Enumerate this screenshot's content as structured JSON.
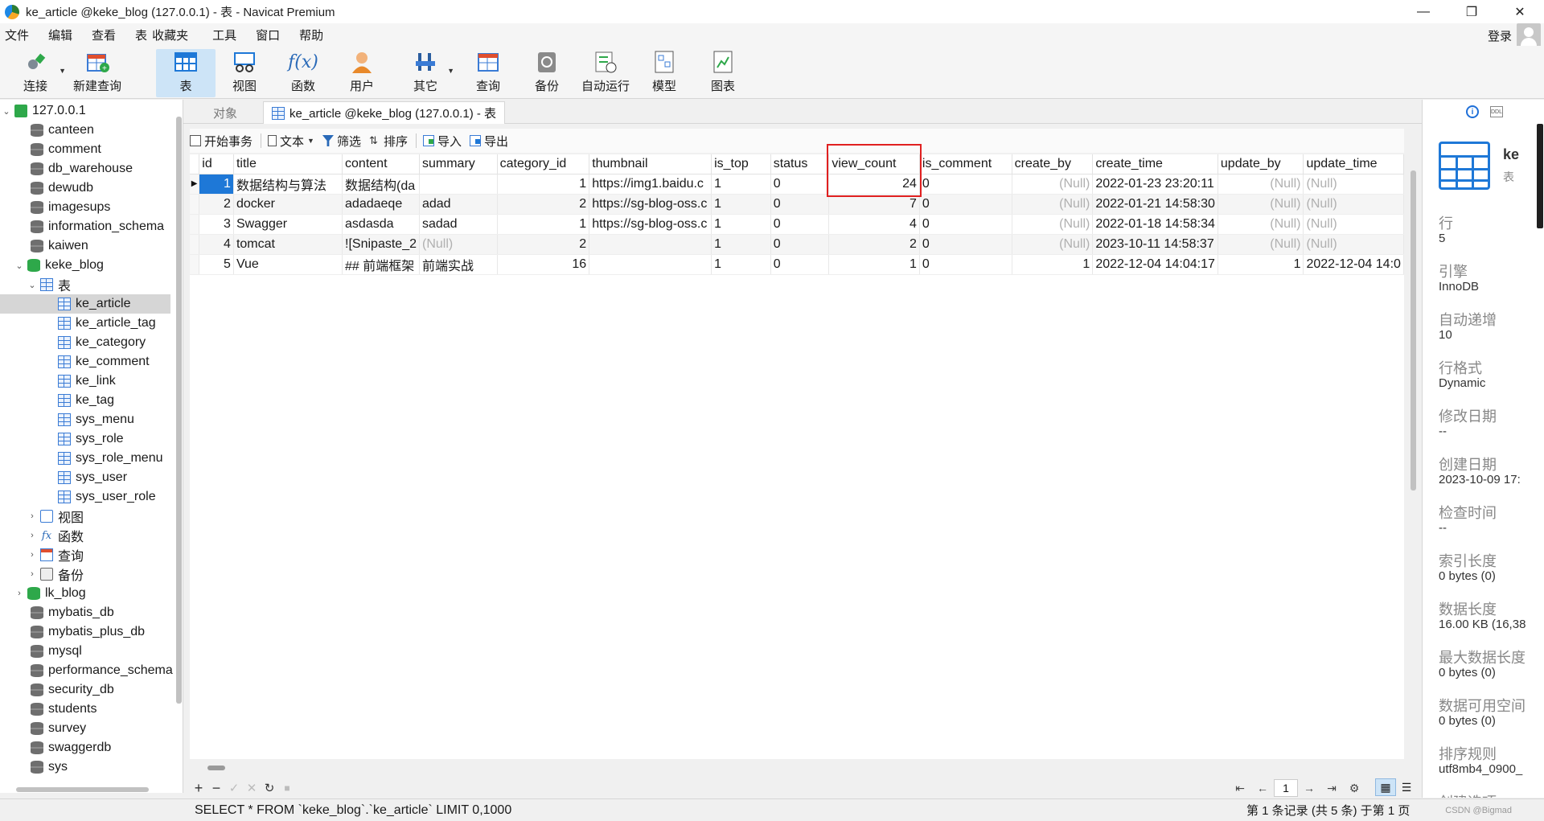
{
  "window": {
    "title": "ke_article @keke_blog (127.0.0.1) - 表 - Navicat Premium",
    "controls": [
      "—",
      "❐",
      "✕"
    ]
  },
  "menu": [
    "文件",
    "编辑",
    "查看",
    "表",
    "收藏夹",
    "工具",
    "窗口",
    "帮助"
  ],
  "login_label": "登录",
  "toolbar": {
    "connect": "连接",
    "new_query": "新建查询",
    "table": "表",
    "view": "视图",
    "function": "函数",
    "user": "用户",
    "other": "其它",
    "query": "查询",
    "backup": "备份",
    "automation": "自动运行",
    "model": "模型",
    "chart": "图表"
  },
  "tree": {
    "server": "127.0.0.1",
    "databases_top": [
      "canteen",
      "comment",
      "db_warehouse",
      "dewudb",
      "imagesups",
      "information_schema",
      "kaiwen"
    ],
    "active_db": "keke_blog",
    "tables_folder": "表",
    "tables": [
      "ke_article",
      "ke_article_tag",
      "ke_category",
      "ke_comment",
      "ke_link",
      "ke_tag",
      "sys_menu",
      "sys_role",
      "sys_role_menu",
      "sys_user",
      "sys_user_role"
    ],
    "folders": [
      "视图",
      "函数",
      "查询",
      "备份"
    ],
    "databases_bottom": [
      "lk_blog",
      "mybatis_db",
      "mybatis_plus_db",
      "mysql",
      "performance_schema",
      "security_db",
      "students",
      "survey",
      "swaggerdb",
      "sys"
    ]
  },
  "tabs": {
    "objects": "对象",
    "active": "ke_article @keke_blog (127.0.0.1) - 表"
  },
  "content_toolbar": {
    "begin_tx": "开始事务",
    "text": "文本",
    "filter": "筛选",
    "sort": "排序",
    "import": "导入",
    "export": "导出"
  },
  "grid": {
    "columns": [
      "id",
      "title",
      "content",
      "summary",
      "category_id",
      "thumbnail",
      "is_top",
      "status",
      "view_count",
      "is_comment",
      "create_by",
      "create_time",
      "update_by",
      "update_time"
    ],
    "rows": [
      [
        "1",
        "数据结构与算法",
        "数据结构(da",
        "",
        "1",
        "https://img1.baidu.c",
        "1",
        "0",
        "24",
        "0",
        "(Null)",
        "2022-01-23 23:20:11",
        "(Null)",
        "(Null)"
      ],
      [
        "2",
        "docker",
        "adadaeqe",
        "adad",
        "2",
        "https://sg-blog-oss.c",
        "1",
        "0",
        "7",
        "0",
        "(Null)",
        "2022-01-21 14:58:30",
        "(Null)",
        "(Null)"
      ],
      [
        "3",
        "Swagger",
        "asdasda",
        "sadad",
        "1",
        "https://sg-blog-oss.c",
        "1",
        "0",
        "4",
        "0",
        "(Null)",
        "2022-01-18 14:58:34",
        "(Null)",
        "(Null)"
      ],
      [
        "4",
        "tomcat",
        "![Snipaste_2",
        "(Null)",
        "2",
        "",
        "1",
        "0",
        "2",
        "0",
        "(Null)",
        "2023-10-11 14:58:37",
        "(Null)",
        "(Null)"
      ],
      [
        "5",
        "Vue",
        "## 前端框架",
        "前端实战",
        "16",
        "",
        "1",
        "0",
        "1",
        "0",
        "1",
        "2022-12-04 14:04:17",
        "1",
        "2022-12-04 14:0"
      ]
    ]
  },
  "nav": {
    "add": "+",
    "remove": "−",
    "apply": "✓",
    "discard": "✕",
    "refresh": "↻",
    "stop": "■",
    "first": "⇤",
    "prev": "←",
    "page": "1",
    "next": "→",
    "last": "⇥",
    "settings": "⚙"
  },
  "status": {
    "sql": "SELECT * FROM `keke_blog`.`ke_article` LIMIT 0,1000",
    "records": "第 1 条记录 (共 5 条) 于第 1 页",
    "watermark": "CSDN @Bigmad"
  },
  "info_panel": {
    "name": "ke",
    "type": "表",
    "props": [
      {
        "label": "行",
        "value": "5"
      },
      {
        "label": "引擎",
        "value": "InnoDB"
      },
      {
        "label": "自动递增",
        "value": "10"
      },
      {
        "label": "行格式",
        "value": "Dynamic"
      },
      {
        "label": "修改日期",
        "value": "--"
      },
      {
        "label": "创建日期",
        "value": "2023-10-09 17:"
      },
      {
        "label": "检查时间",
        "value": "--"
      },
      {
        "label": "索引长度",
        "value": "0 bytes (0)"
      },
      {
        "label": "数据长度",
        "value": "16.00 KB (16,38"
      },
      {
        "label": "最大数据长度",
        "value": "0 bytes (0)"
      },
      {
        "label": "数据可用空间",
        "value": "0 bytes (0)"
      },
      {
        "label": "排序规则",
        "value": "utf8mb4_0900_"
      },
      {
        "label": "创建选项",
        "value": ""
      }
    ]
  },
  "colors": {
    "selection": "#1e78d7",
    "highlight_box": "#e02020",
    "db_active": "#2ea84a",
    "toolbar_active": "#cde4f7"
  }
}
